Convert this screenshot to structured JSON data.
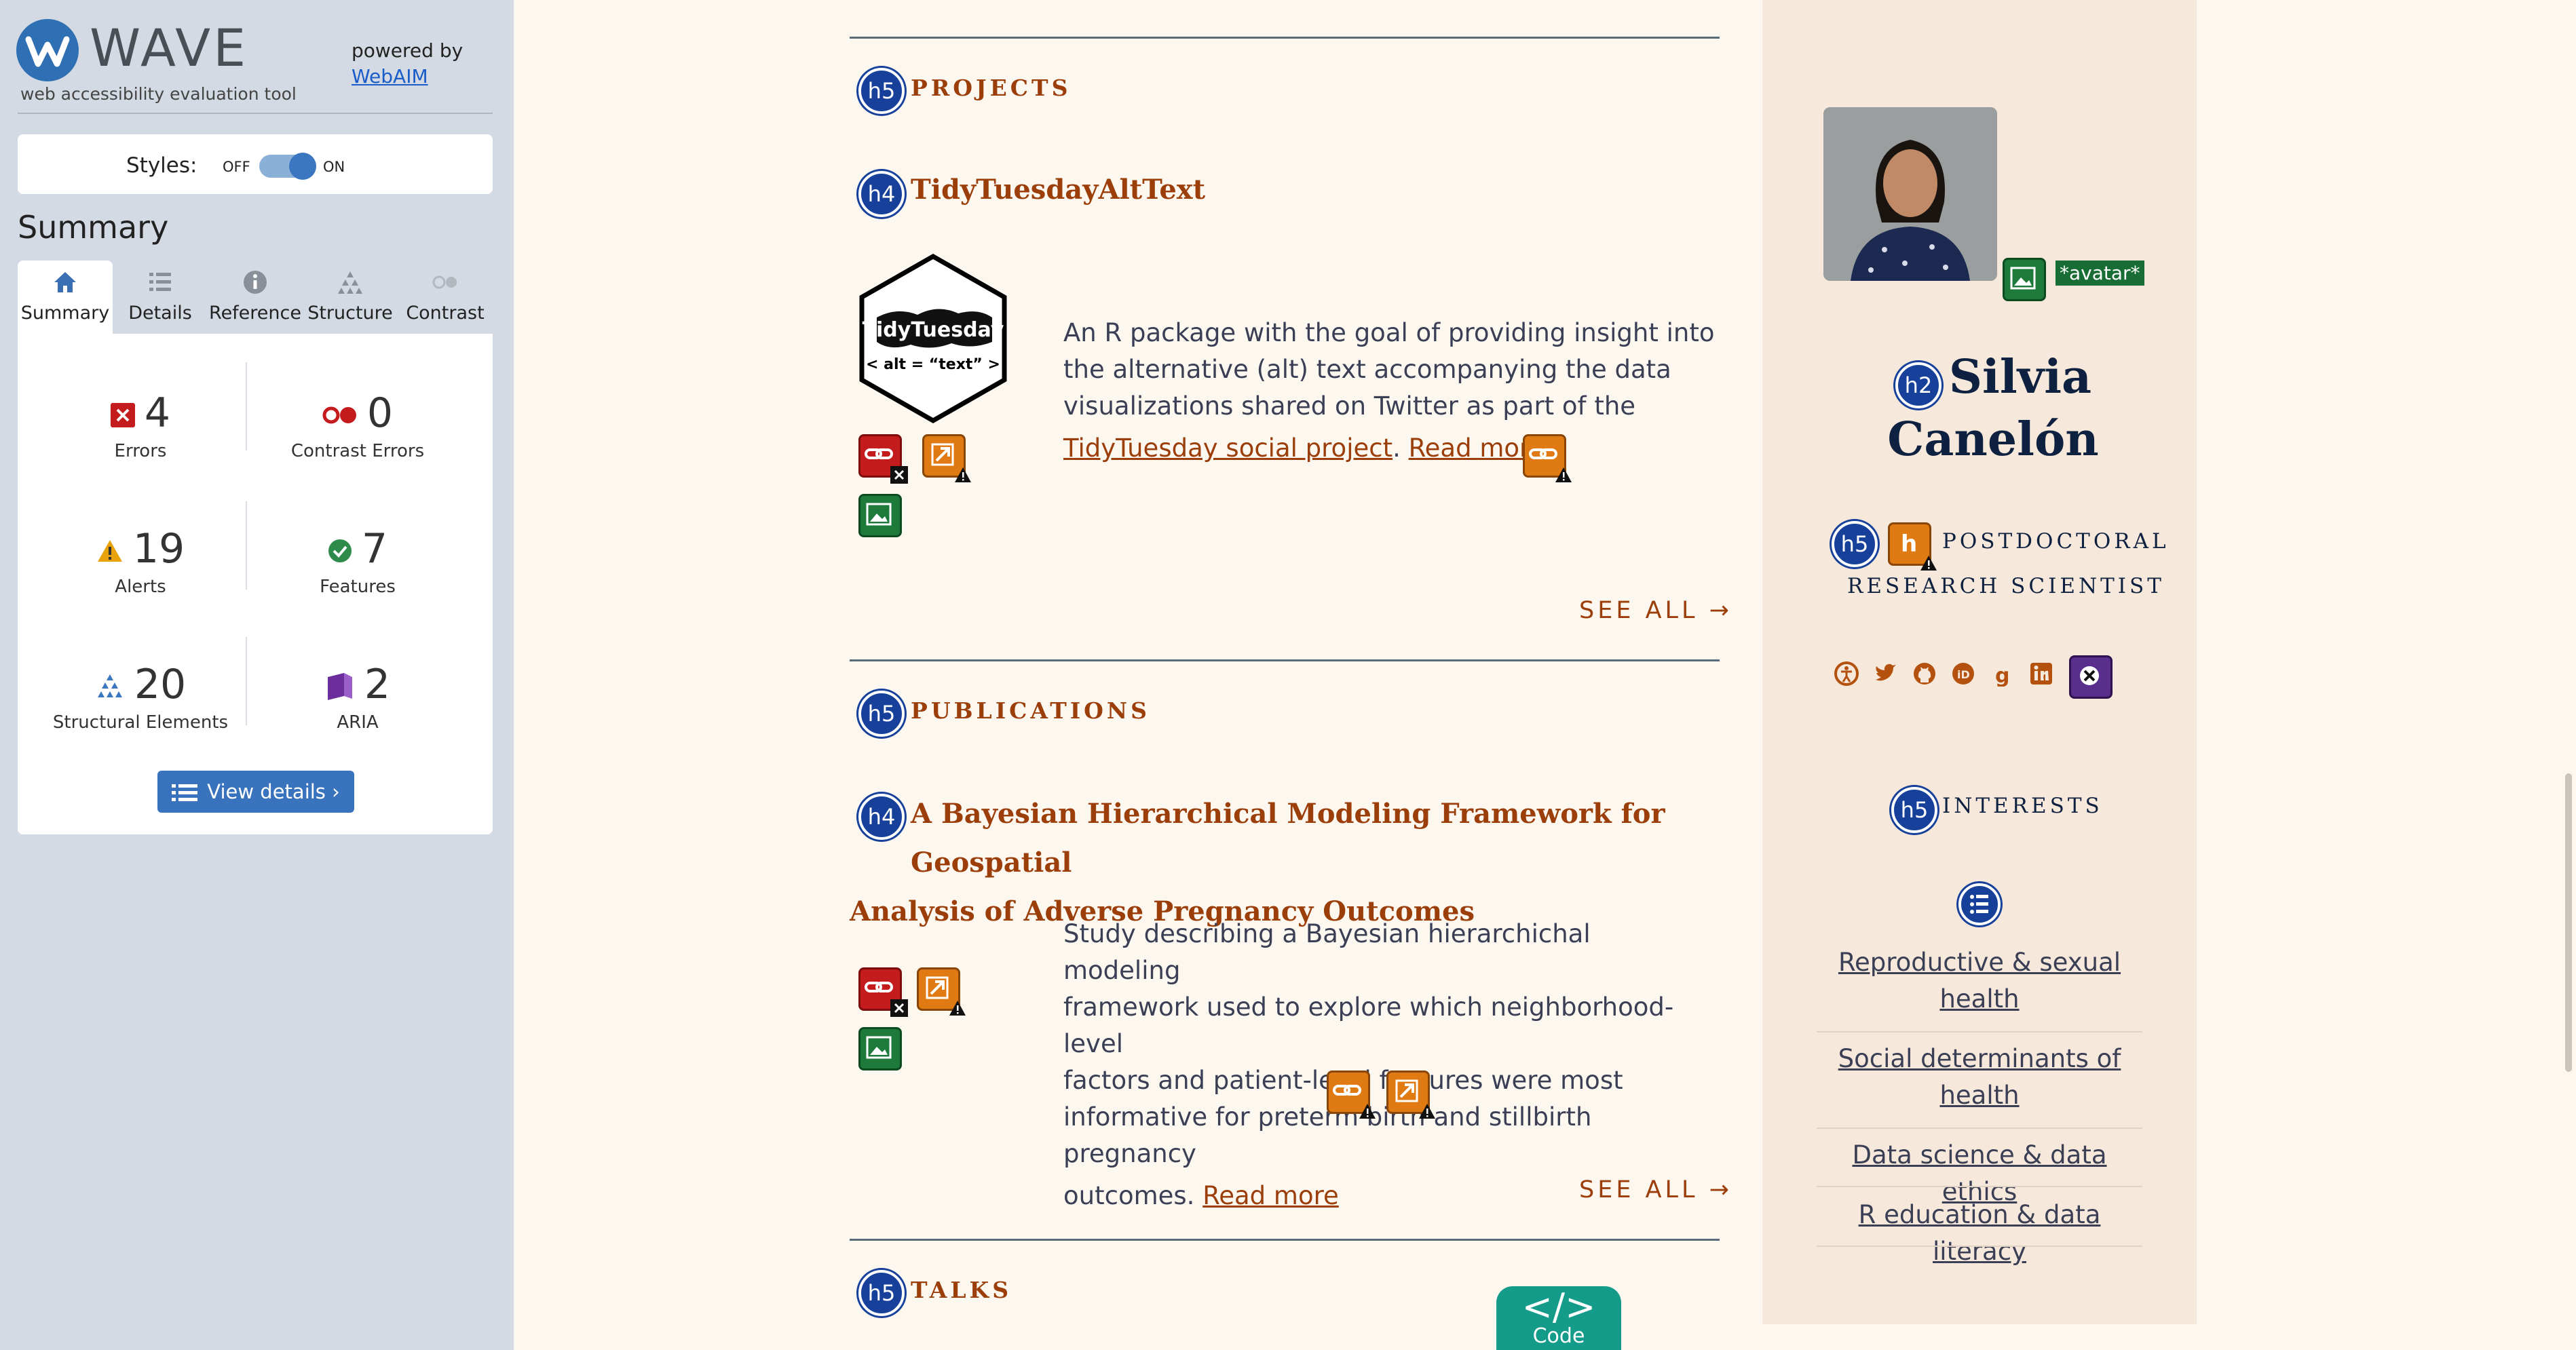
{
  "wave": {
    "logo_word": "WAVE",
    "tagline": "web accessibility evaluation tool",
    "powered_by": "powered by",
    "webaim": "WebAIM",
    "styles_label": "Styles:",
    "styles_off": "OFF",
    "styles_on": "ON",
    "summary_heading": "Summary",
    "tabs": [
      {
        "label": "Summary",
        "icon": "home-icon",
        "active": true
      },
      {
        "label": "Details",
        "icon": "list-icon",
        "active": false
      },
      {
        "label": "Reference",
        "icon": "info-icon",
        "active": false
      },
      {
        "label": "Structure",
        "icon": "structure-icon",
        "active": false
      },
      {
        "label": "Contrast",
        "icon": "contrast-icon",
        "active": false
      }
    ],
    "stats": {
      "errors": {
        "value": "4",
        "label": "Errors"
      },
      "contrast": {
        "value": "0",
        "label": "Contrast Errors"
      },
      "alerts": {
        "value": "19",
        "label": "Alerts"
      },
      "features": {
        "value": "7",
        "label": "Features"
      },
      "structural": {
        "value": "20",
        "label": "Structural Elements"
      },
      "aria": {
        "value": "2",
        "label": "ARIA"
      }
    },
    "view_details": "View details ›"
  },
  "main": {
    "projects": {
      "badge": "h5",
      "heading": "PROJECTS",
      "item": {
        "badge": "h4",
        "title": "TidyTuesdayAltText",
        "logo_line1": "TidyTuesday",
        "logo_line2": "< alt = “text” >",
        "desc_lines": [
          "An R package with the goal of providing insight into",
          "the alternative (alt) text accompanying the data",
          "visualizations shared on Twitter as part of the"
        ],
        "link_text": "TidyTuesday social project",
        "after_link": ".",
        "read_more": "Read more"
      },
      "see_all": "SEE ALL →"
    },
    "publications": {
      "badge": "h5",
      "heading": "PUBLICATIONS",
      "item": {
        "badge": "h4",
        "title_line1": "A Bayesian Hierarchical Modeling Framework for Geospatial",
        "title_line2": "Analysis of Adverse Pregnancy Outcomes",
        "desc_lines": [
          "Study describing a Bayesian hierarchichal modeling",
          "framework used to explore which neighborhood-level",
          "factors and patient-level features were most",
          "informative for preterm birth and stillbirth pregnancy"
        ],
        "last_line": "outcomes.",
        "read_more": "Read more"
      },
      "see_all": "SEE ALL →"
    },
    "talks": {
      "badge": "h5",
      "heading": "TALKS"
    },
    "code_button": {
      "symbol": "</>",
      "label": "Code"
    }
  },
  "aside": {
    "avatar_tag": "*avatar*",
    "name_badge": "h2",
    "name_line1": "Silvia",
    "name_line2": "Canelón",
    "title_badge": "h5",
    "title_line1": "POSTDOCTORAL",
    "title_line2": "RESEARCH SCIENTIST",
    "social_icons": [
      "accessibility-icon",
      "twitter-icon",
      "github-icon",
      "orcid-icon",
      "google-scholar-icon",
      "linkedin-icon"
    ],
    "interests_badge": "h5",
    "interests_heading": "INTERESTS",
    "interests": [
      {
        "line1": "Reproductive & sexual",
        "line2": "health"
      },
      {
        "line1": "Social determinants of",
        "line2": "health"
      },
      {
        "line1": "Data science & data ethics",
        "line2": ""
      },
      {
        "line1": "R education & data literacy",
        "line2": ""
      }
    ]
  }
}
